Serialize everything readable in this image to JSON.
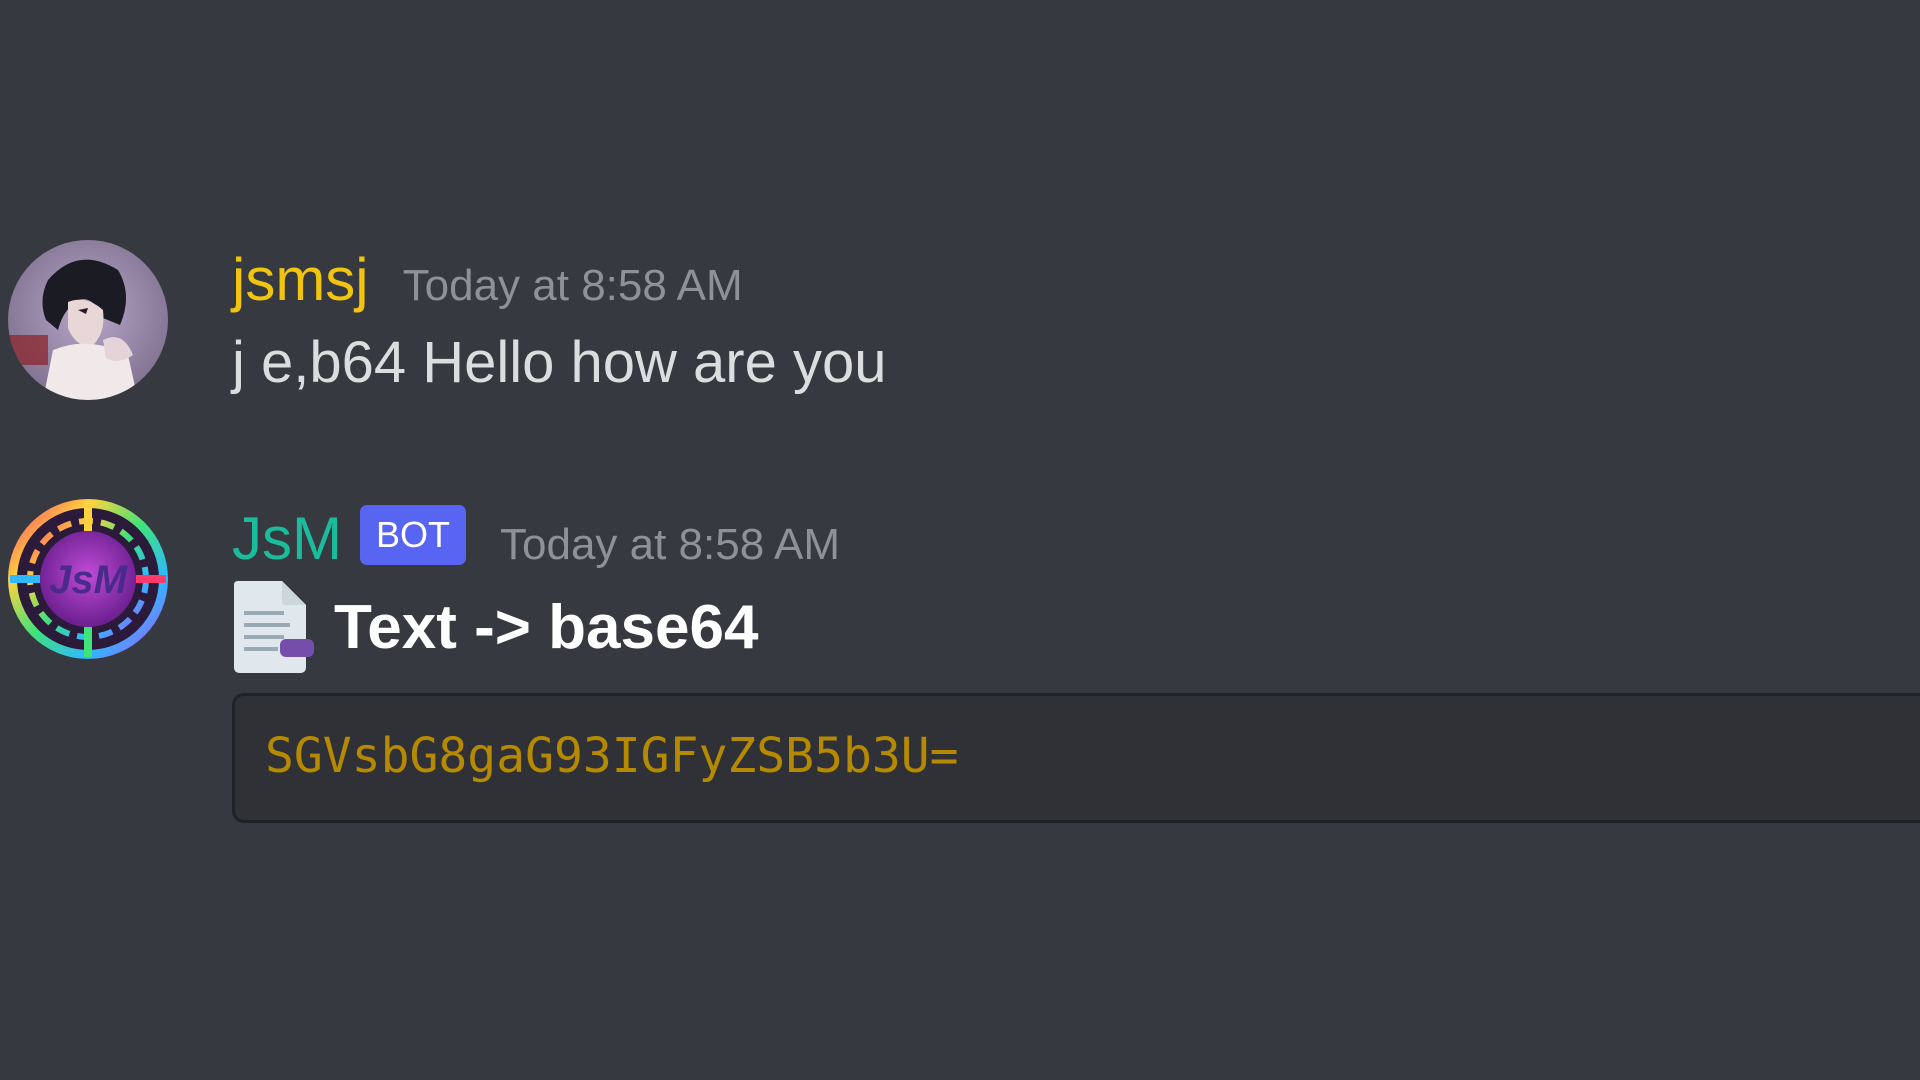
{
  "colors": {
    "background": "#36393f",
    "user_name": "#f1c40f",
    "bot_name": "#1abc9c",
    "bot_tag": "#5865f2",
    "timestamp": "#8e9297",
    "message_text": "#dcddde",
    "code_text": "#b58900",
    "codeblock_bg": "#2f3136"
  },
  "messages": [
    {
      "author": "jsmsj",
      "avatar_icon": "user-avatar-anime",
      "timestamp": "Today at 8:58 AM",
      "content": "j e,b64 Hello how are you"
    },
    {
      "author": "JsM",
      "avatar_icon": "bot-avatar-jsm-logo",
      "avatar_logo_text": "JsM",
      "bot_tag": "BOT",
      "timestamp": "Today at 8:58 AM",
      "embed_icon": "page-document-icon",
      "embed_title": "Text -> base64",
      "code": "SGVsbG8gaG93IGFyZSB5b3U="
    }
  ]
}
